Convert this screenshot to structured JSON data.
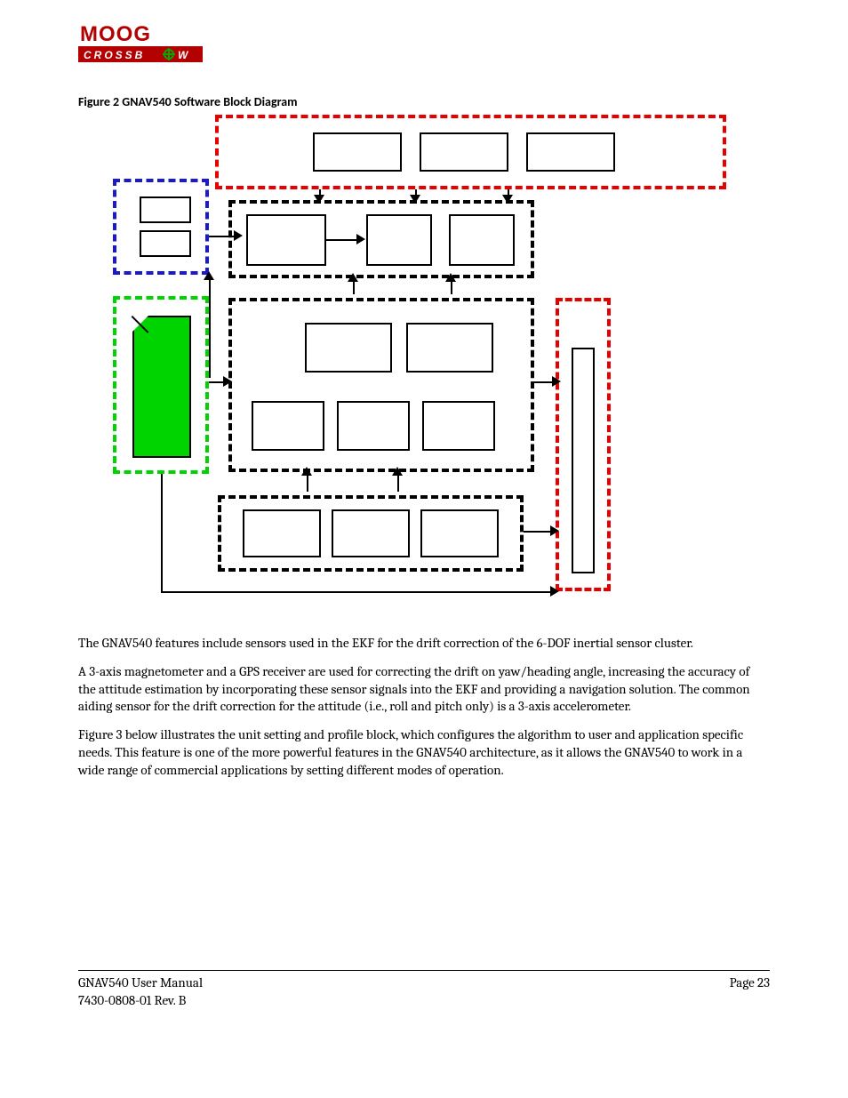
{
  "logo": {
    "brand_top": "MOOG",
    "brand_bottom": "CROSSBOW"
  },
  "figure_caption": "Figure 2  GNAV540 Software Block Diagram",
  "paragraphs": {
    "p1": "The GNAV540 features include sensors used in the EKF for the drift correction of the 6-DOF inertial sensor cluster.",
    "p2": "A 3-axis magnetometer and a GPS receiver are used for correcting the drift on yaw/heading angle, increasing the accuracy of the attitude estimation by incorporating these sensor signals into the EKF and providing a navigation solution. The common aiding sensor for the drift correction for the attitude (i.e., roll and pitch only) is a 3-axis accelerometer.",
    "p3": "Figure 3 below illustrates the unit setting and profile block, which configures the algorithm to user and application specific needs.  This feature is one of the more powerful features in the GNAV540 architecture, as it allows the GNAV540 to work in a wide range of commercial applications by setting different modes of operation."
  },
  "footer": {
    "manual_title": "GNAV540 User Manual",
    "doc_number": "7430-0808-01  Rev. B",
    "page_label": "Page 23"
  }
}
